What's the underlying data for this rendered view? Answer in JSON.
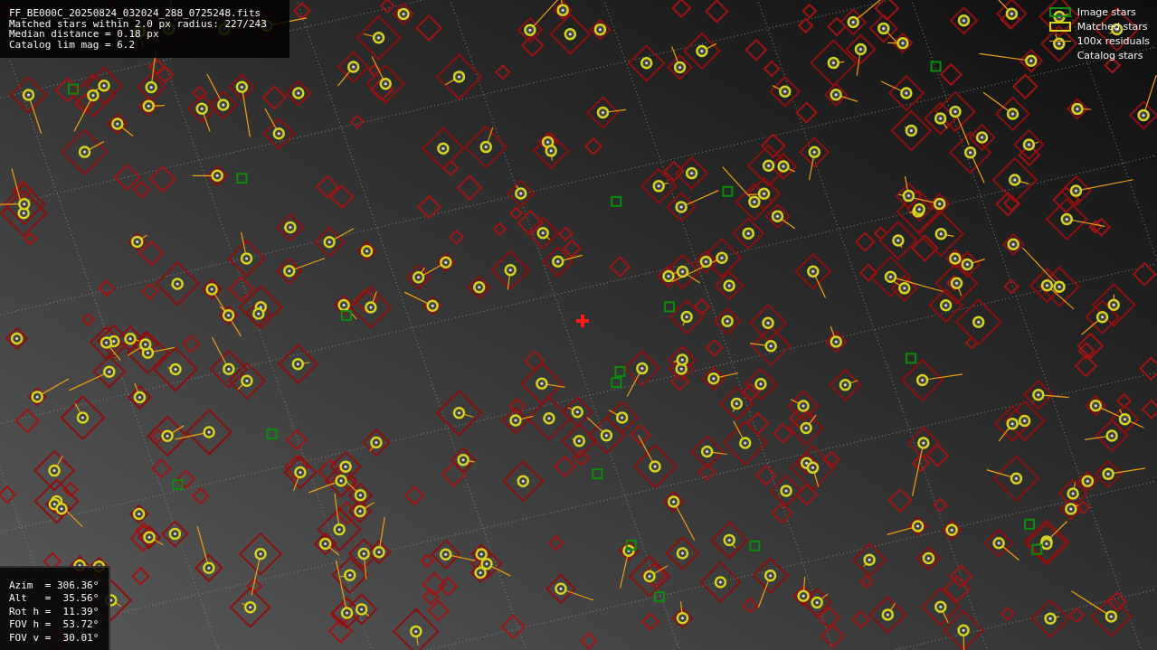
{
  "file_info": {
    "lines": [
      "FF_BE000C_20250824_032024_288_0725248.fits",
      "Matched stars within 2.0 px radius: 227/243",
      "Median distance = 0.18 px",
      "Catalog lim mag = 6.2"
    ]
  },
  "pointing": {
    "lines": [
      "Azim  = 306.36°",
      "Alt   =  35.56°",
      "Rot h =  11.39°",
      "FOV h =  53.72°",
      "FOV v =  30.01°"
    ]
  },
  "legend": [
    {
      "kind": "image",
      "label": "Image stars"
    },
    {
      "kind": "matched",
      "label": "Matched stars"
    },
    {
      "kind": "residual",
      "label": "100x residuals"
    },
    {
      "kind": "catalog",
      "label": "Catalog stars"
    }
  ]
}
